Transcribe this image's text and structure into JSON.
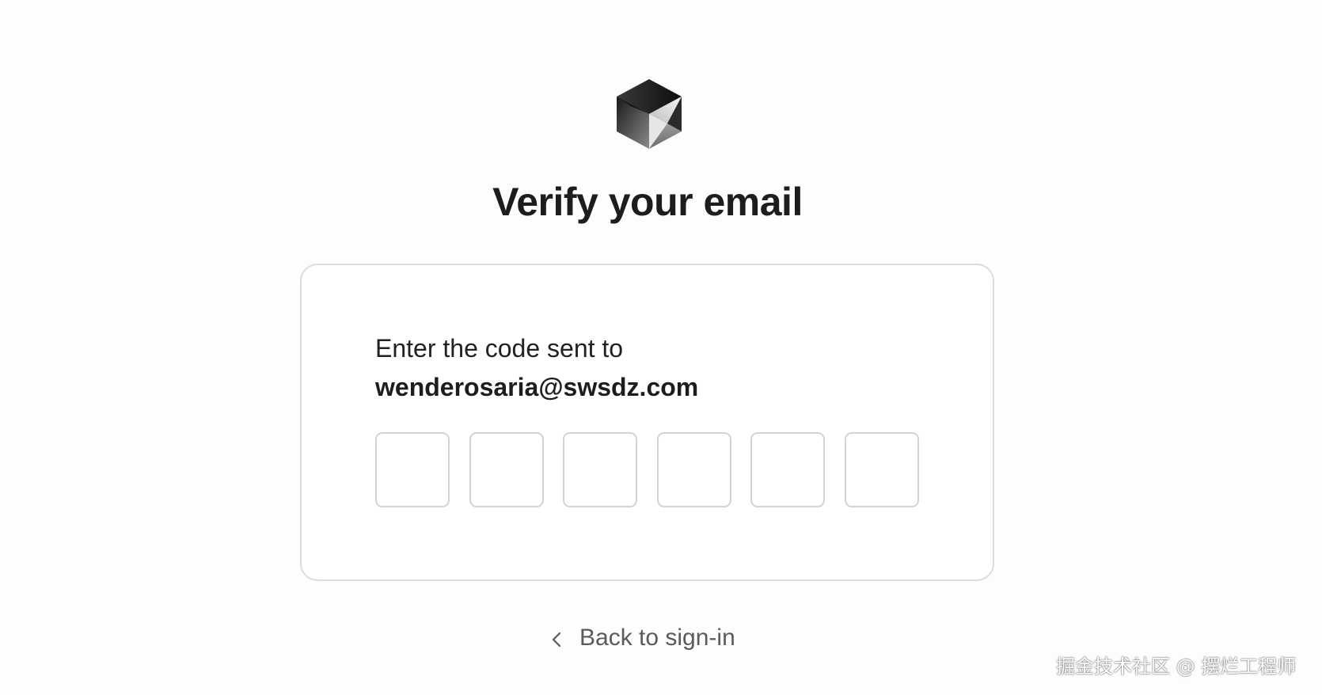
{
  "logo": {
    "icon": "cube-logo-icon"
  },
  "heading": "Verify your email",
  "card": {
    "prompt": "Enter the code sent to",
    "email": "wenderosaria@swsdz.com",
    "code_digits": [
      "",
      "",
      "",
      "",
      "",
      ""
    ]
  },
  "back_link": {
    "icon": "chevron-left-icon",
    "label": "Back to sign-in"
  },
  "watermark": "掘金技术社区 @ 摆烂工程师",
  "colors": {
    "background": "#fdfdfd",
    "card_border": "#dcdcdc",
    "input_border": "#d3d3d3",
    "text_primary": "#1d1d1d",
    "text_muted": "#5a5a5a"
  }
}
